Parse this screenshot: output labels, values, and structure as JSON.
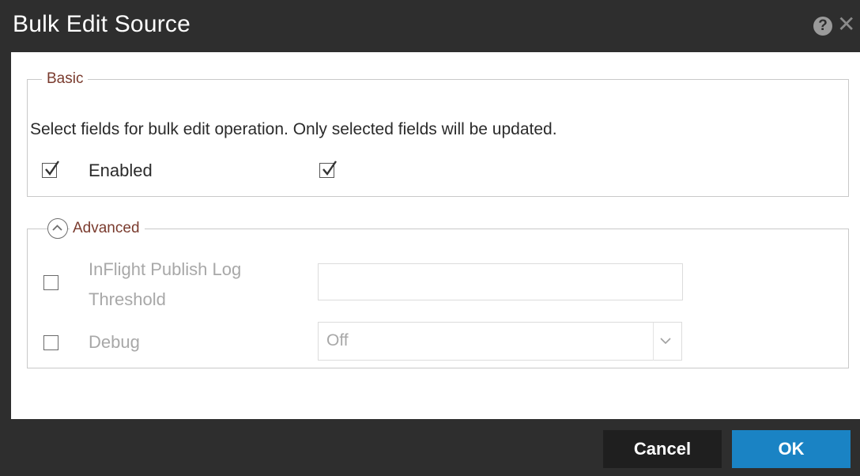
{
  "dialog": {
    "title": "Bulk Edit Source",
    "help_icon": "question-circle-icon",
    "close_icon": "close-x-icon",
    "help_glyph": "?",
    "close_glyph": "✕"
  },
  "basic": {
    "legend": "Basic",
    "description": "Select fields for bulk edit operation. Only selected fields will be updated.",
    "fields": [
      {
        "label": "Enabled",
        "selected": true,
        "value_checked": true
      }
    ]
  },
  "advanced": {
    "legend": "Advanced",
    "collapse_icon": "chevron-up-circle-icon",
    "fields": [
      {
        "label_line1": "InFlight Publish Log",
        "label_line2": "Threshold",
        "selected": false,
        "value": ""
      },
      {
        "label": "Debug",
        "selected": false,
        "select_value": "Off"
      }
    ]
  },
  "footer": {
    "cancel_label": "Cancel",
    "ok_label": "OK"
  },
  "colors": {
    "titlebar": "#2e2e2e",
    "legend_text": "#7a3b2e",
    "ok_button": "#1a83c4",
    "cancel_button": "#1f1f1f",
    "disabled_text": "#a8a8a8"
  }
}
